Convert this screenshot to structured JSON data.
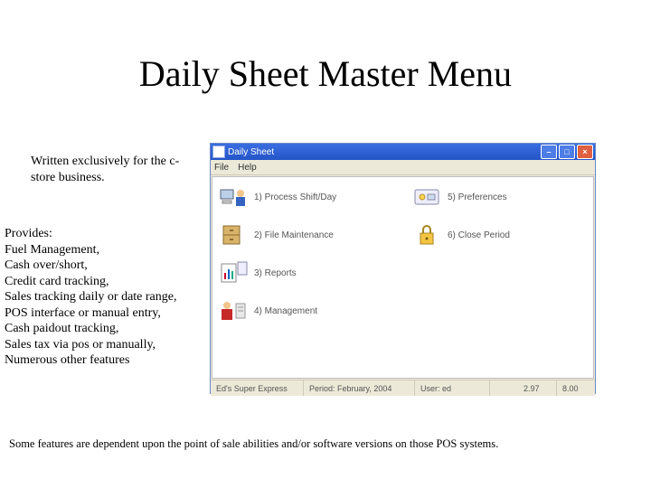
{
  "title": "Daily Sheet Master Menu",
  "tagline": "Written exclusively for the c-store business.",
  "features_header": "Provides:",
  "features": [
    "Fuel Management,",
    "Cash over/short,",
    "Credit card tracking,",
    "Sales tracking daily or date range,",
    "POS interface or manual entry,",
    "Cash paidout tracking,",
    "Sales tax via pos or manually,",
    "Numerous other features"
  ],
  "footnote": "Some features are dependent upon the point of sale abilities and/or software versions on those POS systems.",
  "app": {
    "window_title": "Daily Sheet",
    "menus": [
      "File",
      "Help"
    ],
    "items": [
      {
        "key": "process",
        "label": "1) Process Shift/Day"
      },
      {
        "key": "filemaint",
        "label": "2) File Maintenance"
      },
      {
        "key": "reports",
        "label": "3) Reports"
      },
      {
        "key": "management",
        "label": "4) Management"
      },
      {
        "key": "preferences",
        "label": "5) Preferences"
      },
      {
        "key": "close",
        "label": "6) Close Period"
      }
    ],
    "status": {
      "left": "Ed's Super Express",
      "period": "Period: February, 2004",
      "user": "User: ed",
      "ver1": "2.97",
      "ver2": "8.00"
    }
  }
}
